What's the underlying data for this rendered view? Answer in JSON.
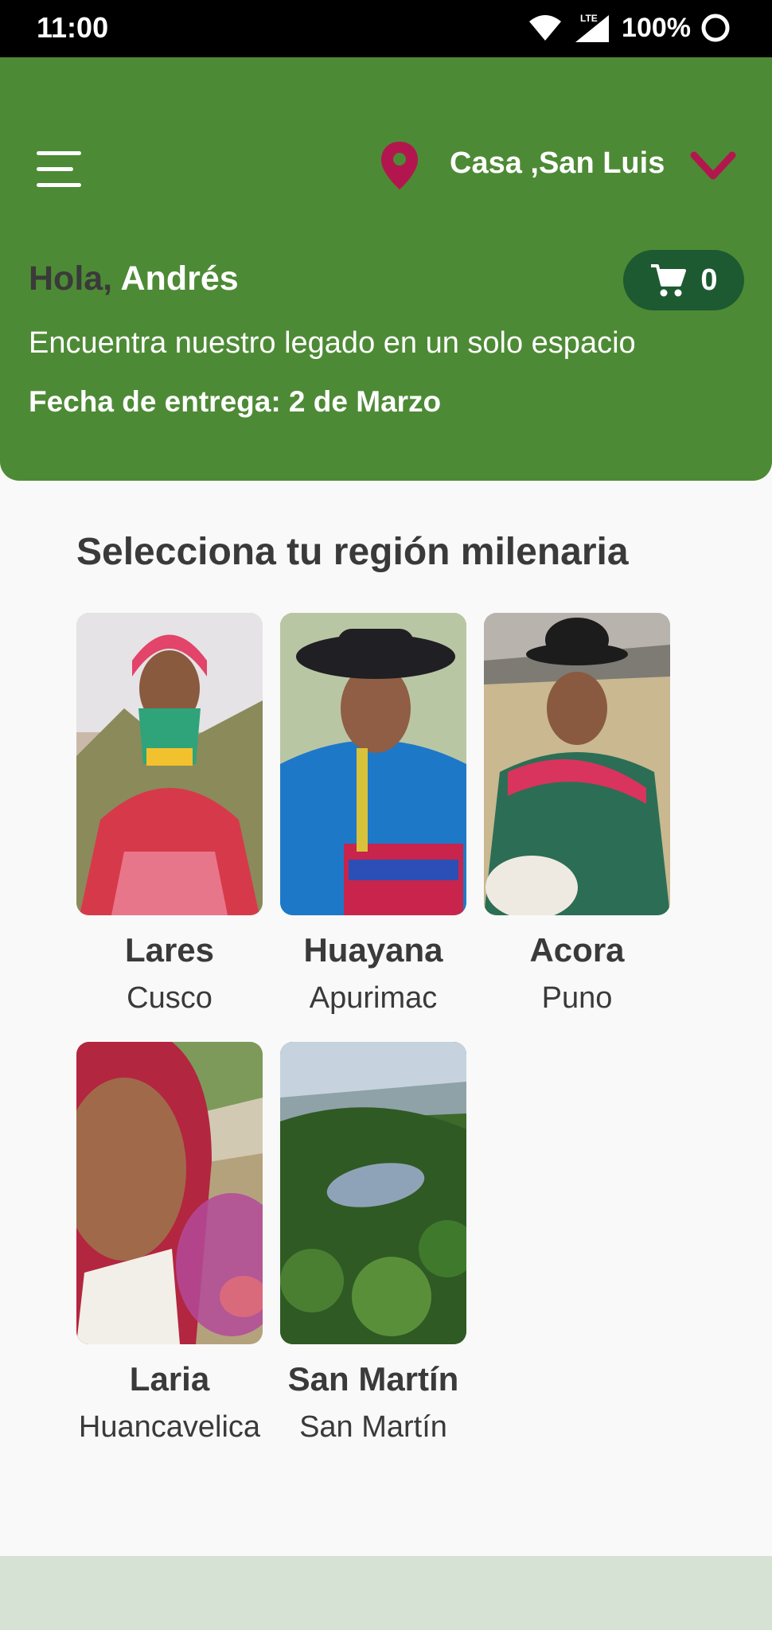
{
  "status_bar": {
    "time": "11:00",
    "network": "LTE",
    "battery": "100%",
    "icons": [
      "wifi-icon",
      "signal-icon",
      "battery-icon"
    ]
  },
  "header": {
    "menu_icon": "hamburger-menu-icon",
    "location_icon": "location-pin-icon",
    "location": "Casa ,San Luis",
    "dropdown_icon": "chevron-down-icon",
    "greeting_prefix": "Hola,",
    "user_name": "Andrés",
    "cart_icon": "shopping-cart-icon",
    "cart_count": "0",
    "subtitle": "Encuentra nuestro legado en un solo espacio",
    "delivery": "Fecha de entrega: 2 de Marzo"
  },
  "main": {
    "section_title": "Selecciona tu región milenaria",
    "regions": [
      {
        "name": "Lares",
        "region": "Cusco"
      },
      {
        "name": "Huayana",
        "region": "Apurimac"
      },
      {
        "name": "Acora",
        "region": "Puno"
      },
      {
        "name": "Laria",
        "region": "Huancavelica"
      },
      {
        "name": "San Martín",
        "region": "San Martín"
      }
    ]
  },
  "colors": {
    "header_green": "#4d8a35",
    "cart_green": "#1d5a31",
    "accent_magenta": "#b3164f",
    "text_dark": "#3a3a3a",
    "bottom_band": "#d6e2d3"
  }
}
